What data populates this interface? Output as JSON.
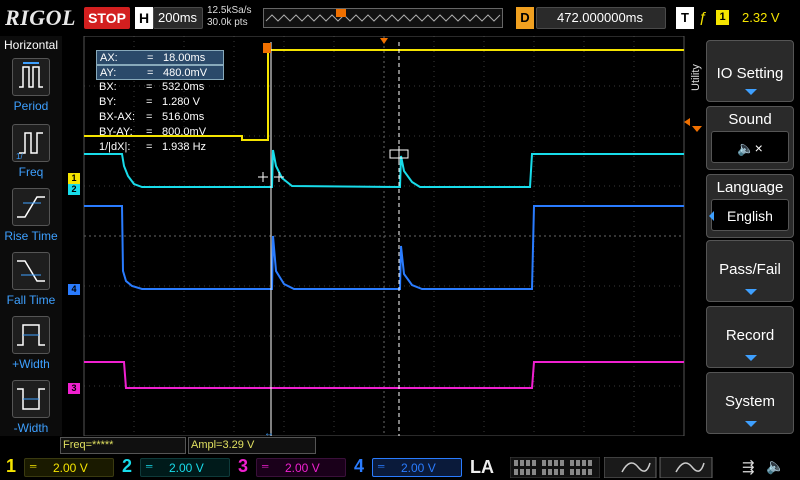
{
  "brand": "RIGOL",
  "run_state": "STOP",
  "timebase": {
    "label": "H",
    "value": "200ms"
  },
  "sample": {
    "rate": "12.5kSa/s",
    "points": "30.0k pts"
  },
  "delay": {
    "label": "D",
    "value": "472.000000ms"
  },
  "trigger": {
    "label": "T",
    "channel": "1",
    "level": "2.32 V"
  },
  "left_panel": {
    "title": "Horizontal",
    "items": [
      "Period",
      "Freq",
      "Rise Time",
      "Fall Time",
      "+Width",
      "-Width"
    ]
  },
  "cursors": [
    {
      "key": "AX:",
      "value": "18.00ms"
    },
    {
      "key": "AY:",
      "value": "480.0mV"
    },
    {
      "key": "BX:",
      "value": "532.0ms"
    },
    {
      "key": "BY:",
      "value": "1.280 V"
    },
    {
      "key": "BX-AX:",
      "value": "516.0ms"
    },
    {
      "key": "BY-AY:",
      "value": "800.0mV"
    },
    {
      "key": "1/|dX|:",
      "value": "1.938 Hz"
    }
  ],
  "right_menu": {
    "utility_tab": "Utility",
    "buttons": [
      {
        "label": "IO Setting",
        "sub": ""
      },
      {
        "label": "Sound",
        "sub": "🔈×"
      },
      {
        "label": "Language",
        "sub": "English"
      },
      {
        "label": "Pass/Fail",
        "sub": ""
      },
      {
        "label": "Record",
        "sub": ""
      },
      {
        "label": "System",
        "sub": ""
      }
    ]
  },
  "measurements": {
    "freq": "Freq=*****",
    "ampl": "Ampl=3.29 V"
  },
  "channels": [
    {
      "num": "1",
      "vdiv": "2.00 V",
      "color": "#f5e400"
    },
    {
      "num": "2",
      "vdiv": "2.00 V",
      "color": "#18dcea"
    },
    {
      "num": "3",
      "vdiv": "2.00 V",
      "color": "#f020d0"
    },
    {
      "num": "4",
      "vdiv": "2.00 V",
      "color": "#2a7cff"
    }
  ],
  "la_label": "LA",
  "markers": {
    "ch1": "1",
    "ch2": "2",
    "ch4": "4",
    "ch3": "3"
  }
}
